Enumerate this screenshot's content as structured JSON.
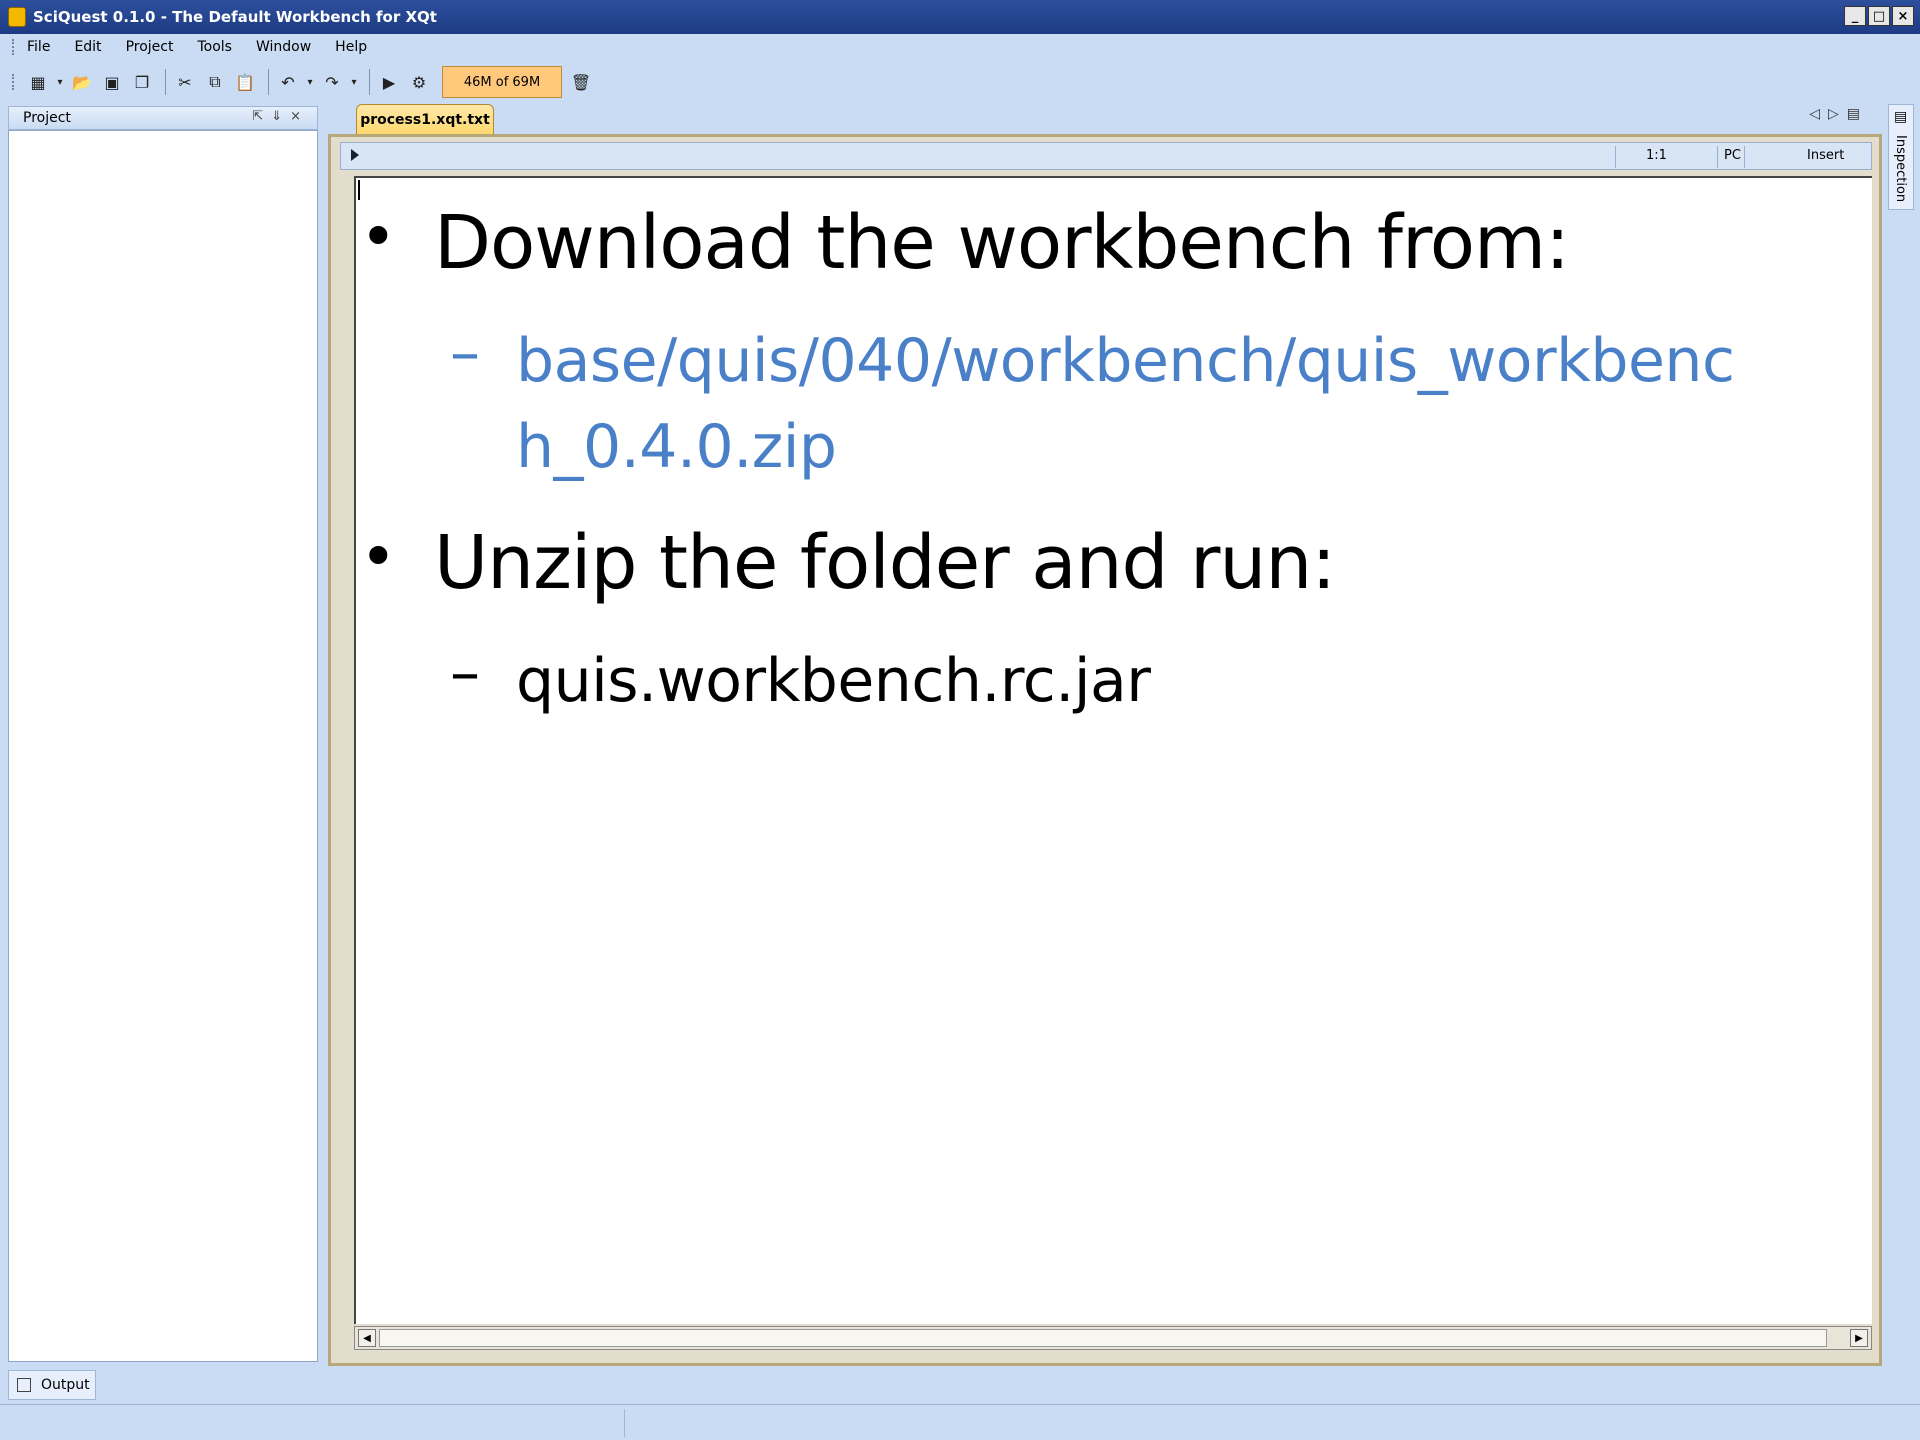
{
  "window": {
    "title": "SciQuest 0.1.0 - The Default Workbench for XQt",
    "buttons": [
      "_",
      "□",
      "×"
    ]
  },
  "menubar": {
    "items": [
      "File",
      "Edit",
      "Project",
      "Tools",
      "Window",
      "Help"
    ]
  },
  "toolbar": {
    "memory": "46M of 69M"
  },
  "project_panel": {
    "title": "Project"
  },
  "editor": {
    "tab": "process1.xqt.txt",
    "status": {
      "position": "1:1",
      "line_ending": "PC",
      "mode": "Insert"
    }
  },
  "slide": {
    "bullet1": "Download the workbench from:",
    "sub1_line1": "base/quis/040/workbench/quis_workbenc",
    "sub1_line2": "h_0.4.0.zip",
    "bullet2": "Unzip the folder and run:",
    "sub2": "quis.workbench.rc.jar",
    "bullet_char": "•",
    "dash_char": "–",
    "link_color": "#4a80c8"
  },
  "side_tabs": {
    "inspection": "Inspection",
    "output": "Output"
  }
}
